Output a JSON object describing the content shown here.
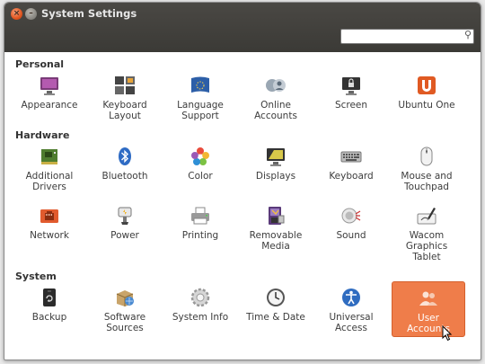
{
  "window": {
    "title": "System Settings"
  },
  "search": {
    "placeholder": ""
  },
  "sections": {
    "personal": "Personal",
    "hardware": "Hardware",
    "system": "System"
  },
  "personal": [
    {
      "label": "Appearance",
      "icon": "appearance-icon"
    },
    {
      "label": "Keyboard Layout",
      "icon": "keyboard-layout-icon"
    },
    {
      "label": "Language Support",
      "icon": "language-icon"
    },
    {
      "label": "Online Accounts",
      "icon": "online-accounts-icon"
    },
    {
      "label": "Screen",
      "icon": "screen-lock-icon"
    },
    {
      "label": "Ubuntu One",
      "icon": "ubuntu-one-icon"
    }
  ],
  "hardware": [
    {
      "label": "Additional Drivers",
      "icon": "chip-icon"
    },
    {
      "label": "Bluetooth",
      "icon": "bluetooth-icon"
    },
    {
      "label": "Color",
      "icon": "color-icon"
    },
    {
      "label": "Displays",
      "icon": "displays-icon"
    },
    {
      "label": "Keyboard",
      "icon": "keyboard-icon"
    },
    {
      "label": "Mouse and Touchpad",
      "icon": "mouse-icon"
    },
    {
      "label": "Network",
      "icon": "network-icon"
    },
    {
      "label": "Power",
      "icon": "power-icon"
    },
    {
      "label": "Printing",
      "icon": "printer-icon"
    },
    {
      "label": "Removable Media",
      "icon": "removable-media-icon"
    },
    {
      "label": "Sound",
      "icon": "sound-icon"
    },
    {
      "label": "Wacom Graphics Tablet",
      "icon": "wacom-tablet-icon"
    }
  ],
  "system": [
    {
      "label": "Backup",
      "icon": "backup-icon"
    },
    {
      "label": "Software Sources",
      "icon": "software-sources-icon"
    },
    {
      "label": "System Info",
      "icon": "system-info-icon"
    },
    {
      "label": "Time & Date",
      "icon": "clock-icon"
    },
    {
      "label": "Universal Access",
      "icon": "universal-access-icon"
    },
    {
      "label": "User Accounts",
      "icon": "user-accounts-icon"
    }
  ],
  "colors": {
    "selected": "#ef7d4a",
    "titlebar": "#3c3b37"
  }
}
